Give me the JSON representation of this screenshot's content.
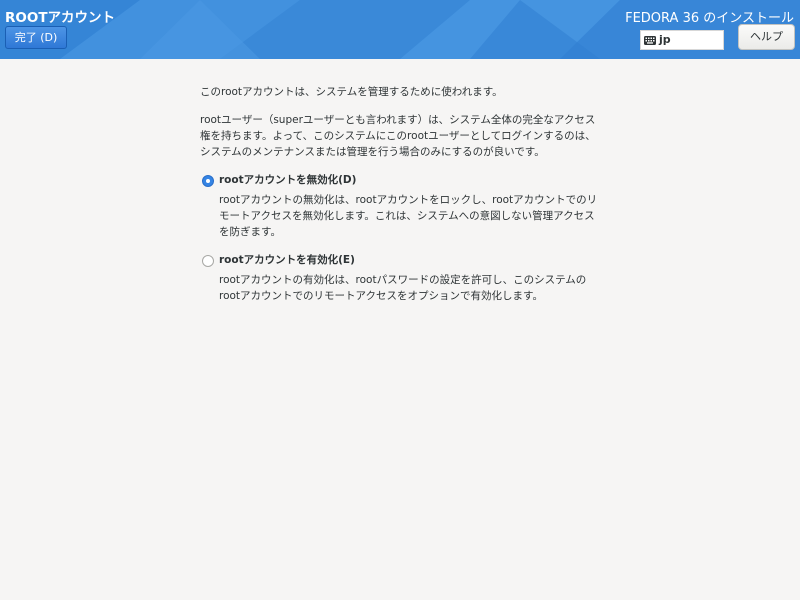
{
  "header": {
    "page_title": "ROOTアカウント",
    "done_button_label": "完了 (D)",
    "product_title": "FEDORA 36 のインストール",
    "keyboard_layout": "jp",
    "help_button_label": "ヘルプ",
    "accent_color": "#3b8cdb"
  },
  "main": {
    "intro": "このrootアカウントは、システムを管理するために使われます。",
    "description": "rootユーザー（superユーザーとも言われます）は、システム全体の完全なアクセス権を持ちます。よって、このシステムにこのrootユーザーとしてログインするのは、システムのメンテナンスまたは管理を行う場合のみにするのが良いです。",
    "options": [
      {
        "label": "rootアカウントを無効化(D)",
        "description": "rootアカウントの無効化は、rootアカウントをロックし、rootアカウントでのリモートアクセスを無効化します。これは、システムへの意図しない管理アクセスを防ぎます。",
        "selected": true
      },
      {
        "label": "rootアカウントを有効化(E)",
        "description": "rootアカウントの有効化は、rootパスワードの設定を許可し、このシステムのrootアカウントでのリモートアクセスをオプションで有効化します。",
        "selected": false
      }
    ]
  }
}
